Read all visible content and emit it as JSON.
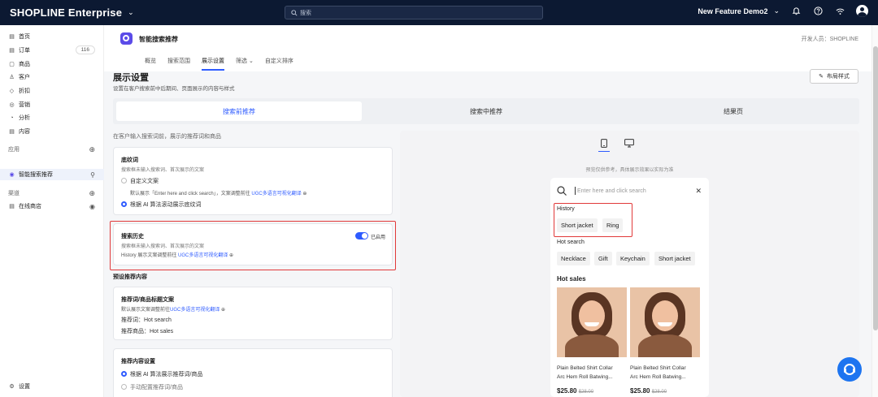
{
  "topbar": {
    "brand": "SHOPLINE Enterprise",
    "brand_caret": "⌄",
    "search_placeholder": "搜索",
    "store_name": "New Feature Demo2",
    "store_caret": "⌄"
  },
  "sidebar": {
    "items": [
      {
        "icon": "▤",
        "label": "首页"
      },
      {
        "icon": "▤",
        "label": "订单",
        "badge": "116"
      },
      {
        "icon": "▢",
        "label": "商品"
      },
      {
        "icon": "♙",
        "label": "客户"
      },
      {
        "icon": "◇",
        "label": "折扣"
      },
      {
        "icon": "◎",
        "label": "营销"
      },
      {
        "icon": "◔",
        "label": "分析"
      },
      {
        "icon": "▤",
        "label": "内容"
      }
    ],
    "apps_label": "应用",
    "active_app": "智能搜索推荐",
    "channels_label": "渠道",
    "online_store": "在线商店",
    "settings": "设置"
  },
  "header": {
    "app_title": "智能搜索推荐",
    "developer": "开发人员：SHOPLINE",
    "tabs": [
      "概览",
      "搜索范围",
      "展示设置",
      "筛选",
      "自定义排序"
    ],
    "active_tab": 2
  },
  "page": {
    "title": "展示设置",
    "subtitle": "设置在客户搜索前中后期间、页面展示的内容与样式",
    "layout_button": "布局样式",
    "segments": [
      "搜索前推荐",
      "搜索中推荐",
      "结果页"
    ],
    "left_hint": "在客户输入搜索词前，展示的推荐词和商品"
  },
  "cards": {
    "shading": {
      "title": "底纹词",
      "subtitle": "搜索框未输入搜索词、首次展示的文案",
      "option1": "自定义文案",
      "default_hint_prefix": "默认展示「Enter here and click search」，文案调整前往 ",
      "link": "UGC多语言可视化翻译",
      "option2": "根据 AI 算法滚动展示底纹词"
    },
    "history": {
      "title": "搜索历史",
      "subtitle": "搜索框未输入搜索词、首次展示的文案",
      "hint_prefix": "History 展示文案调整前往 ",
      "link": "UGC多语言可视化翻译",
      "toggle_label": "已启用"
    },
    "preset_section": "预设推荐内容",
    "rec_title": {
      "title": "推荐词/商品标题文案",
      "hint_prefix": "默认展示文案调整前往",
      "link": "UGC多语言可视化翻译",
      "line1": "推荐词：Hot search",
      "line2": "推荐商品：Hot sales"
    },
    "rec_content": {
      "title": "推荐内容设置",
      "option1": "根据 AI 算法展示推荐词/商品",
      "option2": "手动配置推荐词/商品"
    }
  },
  "preview": {
    "note": "预览仅供参考，具体展示效果以实际为准",
    "search_placeholder": "Enter here and click search",
    "history_label": "History",
    "history_chips": [
      "Short jacket",
      "Ring"
    ],
    "hot_search_label": "Hot search",
    "hot_chips": [
      "Necklace",
      "Gift",
      "Keychain",
      "Short jacket"
    ],
    "hot_sales_label": "Hot sales",
    "products": [
      {
        "name1": "Plain Belted Shirt Collar",
        "name2": "Arc Hem Roll Batwing...",
        "price": "$25.80",
        "old": "$28.00"
      },
      {
        "name1": "Plain Belted Shirt Collar",
        "name2": "Arc Hem Roll Batwing...",
        "price": "$25.80",
        "old": "$28.00"
      }
    ]
  },
  "colors": {
    "accent": "#2e5bff",
    "topbar": "#0c1932",
    "highlight": "#e13a3a"
  }
}
